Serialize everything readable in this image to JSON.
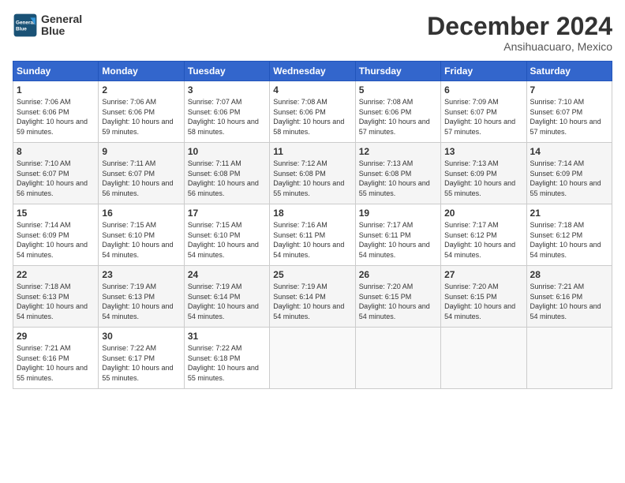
{
  "header": {
    "logo_line1": "General",
    "logo_line2": "Blue",
    "month": "December 2024",
    "location": "Ansihuacuaro, Mexico"
  },
  "weekdays": [
    "Sunday",
    "Monday",
    "Tuesday",
    "Wednesday",
    "Thursday",
    "Friday",
    "Saturday"
  ],
  "weeks": [
    [
      {
        "day": "1",
        "sunrise": "7:06 AM",
        "sunset": "6:06 PM",
        "daylight": "10 hours and 59 minutes."
      },
      {
        "day": "2",
        "sunrise": "7:06 AM",
        "sunset": "6:06 PM",
        "daylight": "10 hours and 59 minutes."
      },
      {
        "day": "3",
        "sunrise": "7:07 AM",
        "sunset": "6:06 PM",
        "daylight": "10 hours and 58 minutes."
      },
      {
        "day": "4",
        "sunrise": "7:08 AM",
        "sunset": "6:06 PM",
        "daylight": "10 hours and 58 minutes."
      },
      {
        "day": "5",
        "sunrise": "7:08 AM",
        "sunset": "6:06 PM",
        "daylight": "10 hours and 57 minutes."
      },
      {
        "day": "6",
        "sunrise": "7:09 AM",
        "sunset": "6:07 PM",
        "daylight": "10 hours and 57 minutes."
      },
      {
        "day": "7",
        "sunrise": "7:10 AM",
        "sunset": "6:07 PM",
        "daylight": "10 hours and 57 minutes."
      }
    ],
    [
      {
        "day": "8",
        "sunrise": "7:10 AM",
        "sunset": "6:07 PM",
        "daylight": "10 hours and 56 minutes."
      },
      {
        "day": "9",
        "sunrise": "7:11 AM",
        "sunset": "6:07 PM",
        "daylight": "10 hours and 56 minutes."
      },
      {
        "day": "10",
        "sunrise": "7:11 AM",
        "sunset": "6:08 PM",
        "daylight": "10 hours and 56 minutes."
      },
      {
        "day": "11",
        "sunrise": "7:12 AM",
        "sunset": "6:08 PM",
        "daylight": "10 hours and 55 minutes."
      },
      {
        "day": "12",
        "sunrise": "7:13 AM",
        "sunset": "6:08 PM",
        "daylight": "10 hours and 55 minutes."
      },
      {
        "day": "13",
        "sunrise": "7:13 AM",
        "sunset": "6:09 PM",
        "daylight": "10 hours and 55 minutes."
      },
      {
        "day": "14",
        "sunrise": "7:14 AM",
        "sunset": "6:09 PM",
        "daylight": "10 hours and 55 minutes."
      }
    ],
    [
      {
        "day": "15",
        "sunrise": "7:14 AM",
        "sunset": "6:09 PM",
        "daylight": "10 hours and 54 minutes."
      },
      {
        "day": "16",
        "sunrise": "7:15 AM",
        "sunset": "6:10 PM",
        "daylight": "10 hours and 54 minutes."
      },
      {
        "day": "17",
        "sunrise": "7:15 AM",
        "sunset": "6:10 PM",
        "daylight": "10 hours and 54 minutes."
      },
      {
        "day": "18",
        "sunrise": "7:16 AM",
        "sunset": "6:11 PM",
        "daylight": "10 hours and 54 minutes."
      },
      {
        "day": "19",
        "sunrise": "7:17 AM",
        "sunset": "6:11 PM",
        "daylight": "10 hours and 54 minutes."
      },
      {
        "day": "20",
        "sunrise": "7:17 AM",
        "sunset": "6:12 PM",
        "daylight": "10 hours and 54 minutes."
      },
      {
        "day": "21",
        "sunrise": "7:18 AM",
        "sunset": "6:12 PM",
        "daylight": "10 hours and 54 minutes."
      }
    ],
    [
      {
        "day": "22",
        "sunrise": "7:18 AM",
        "sunset": "6:13 PM",
        "daylight": "10 hours and 54 minutes."
      },
      {
        "day": "23",
        "sunrise": "7:19 AM",
        "sunset": "6:13 PM",
        "daylight": "10 hours and 54 minutes."
      },
      {
        "day": "24",
        "sunrise": "7:19 AM",
        "sunset": "6:14 PM",
        "daylight": "10 hours and 54 minutes."
      },
      {
        "day": "25",
        "sunrise": "7:19 AM",
        "sunset": "6:14 PM",
        "daylight": "10 hours and 54 minutes."
      },
      {
        "day": "26",
        "sunrise": "7:20 AM",
        "sunset": "6:15 PM",
        "daylight": "10 hours and 54 minutes."
      },
      {
        "day": "27",
        "sunrise": "7:20 AM",
        "sunset": "6:15 PM",
        "daylight": "10 hours and 54 minutes."
      },
      {
        "day": "28",
        "sunrise": "7:21 AM",
        "sunset": "6:16 PM",
        "daylight": "10 hours and 54 minutes."
      }
    ],
    [
      {
        "day": "29",
        "sunrise": "7:21 AM",
        "sunset": "6:16 PM",
        "daylight": "10 hours and 55 minutes."
      },
      {
        "day": "30",
        "sunrise": "7:22 AM",
        "sunset": "6:17 PM",
        "daylight": "10 hours and 55 minutes."
      },
      {
        "day": "31",
        "sunrise": "7:22 AM",
        "sunset": "6:18 PM",
        "daylight": "10 hours and 55 minutes."
      },
      null,
      null,
      null,
      null
    ]
  ]
}
